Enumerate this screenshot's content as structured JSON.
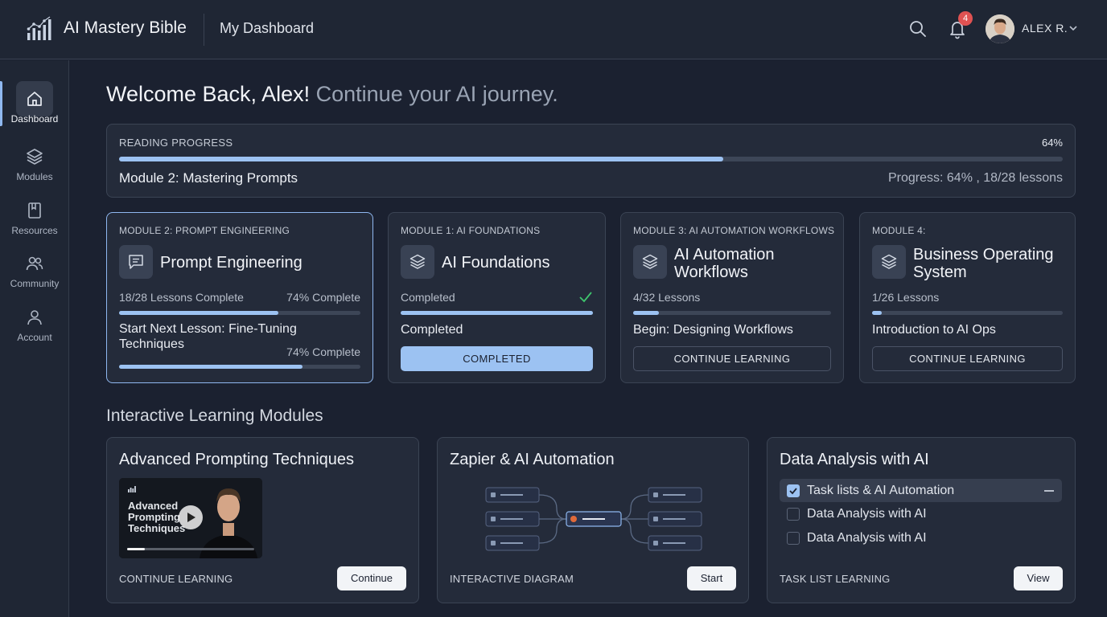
{
  "header": {
    "brand": "AI Mastery Bible",
    "page_title": "My Dashboard",
    "notification_count": "4",
    "user_name": "ALEX R."
  },
  "sidebar": {
    "items": [
      {
        "label": "Dashboard",
        "icon": "home-icon",
        "active": true
      },
      {
        "label": "Modules",
        "icon": "layers-icon"
      },
      {
        "label": "Resources",
        "icon": "book-icon"
      },
      {
        "label": "Community",
        "icon": "users-icon"
      },
      {
        "label": "Account",
        "icon": "user-icon"
      }
    ]
  },
  "welcome": {
    "greeting": "Welcome Back, Alex!",
    "subtitle": "Continue your AI journey."
  },
  "reading_progress": {
    "label": "READING PROGRESS",
    "percent_text": "64%",
    "percent": 0.64,
    "title": "Module 2: Mastering Prompts",
    "status": "Progress: 64% , 18/28 lessons"
  },
  "modules": [
    {
      "label": "MODULE 2: PROMPT ENGINEERING",
      "title": "Prompt Engineering",
      "icon": "chat-icon",
      "left": "18/28 Lessons Complete",
      "right": "74% Complete",
      "progress": 0.66,
      "next": "Start Next Lesson: Fine-Tuning Techniques",
      "next_pct": "74% Complete",
      "next_progress": 0.76
    },
    {
      "label": "MODULE 1: AI FOUNDATIONS",
      "title": "AI Foundations",
      "icon": "layers-icon",
      "left": "Completed",
      "progress": 1.0,
      "next": "Completed",
      "button": "COMPLETED"
    },
    {
      "label": "MODULE 3: AI AUTOMATION WORKFLOWS",
      "title": "AI Automation Workflows",
      "icon": "layers-icon",
      "left": "4/32 Lessons",
      "progress": 0.13,
      "next": "Begin: Designing Workflows",
      "button": "CONTINUE LEARNING"
    },
    {
      "label": "MODULE 4:",
      "title": "Business Operating System",
      "icon": "layers-icon",
      "left": "1/26 Lessons",
      "progress": 0.05,
      "next": "Introduction to AI Ops",
      "button": "CONTINUE LEARNING"
    }
  ],
  "interactive": {
    "section_title": "Interactive Learning Modules",
    "cards": [
      {
        "title": "Advanced Prompting Techniques",
        "video_title": "Advanced Prompting Techniques",
        "video_progress": 0.14,
        "footer": "CONTINUE LEARNING",
        "button": "Continue"
      },
      {
        "title": "Zapier & AI Automation",
        "footer": "INTERACTIVE DIAGRAM",
        "button": "Start"
      },
      {
        "title": "Data Analysis with AI",
        "tasks": [
          {
            "label": "Task lists & AI Automation",
            "checked": true
          },
          {
            "label": "Data Analysis with AI",
            "checked": false
          },
          {
            "label": "Data Analysis with AI",
            "checked": false
          }
        ],
        "footer": "TASK LIST LEARNING",
        "button": "View"
      }
    ]
  },
  "colors": {
    "accent": "#9cc2f2",
    "background": "#1b2130",
    "card": "#242b3a",
    "badge": "#e05252",
    "check": "#3ec46d"
  }
}
